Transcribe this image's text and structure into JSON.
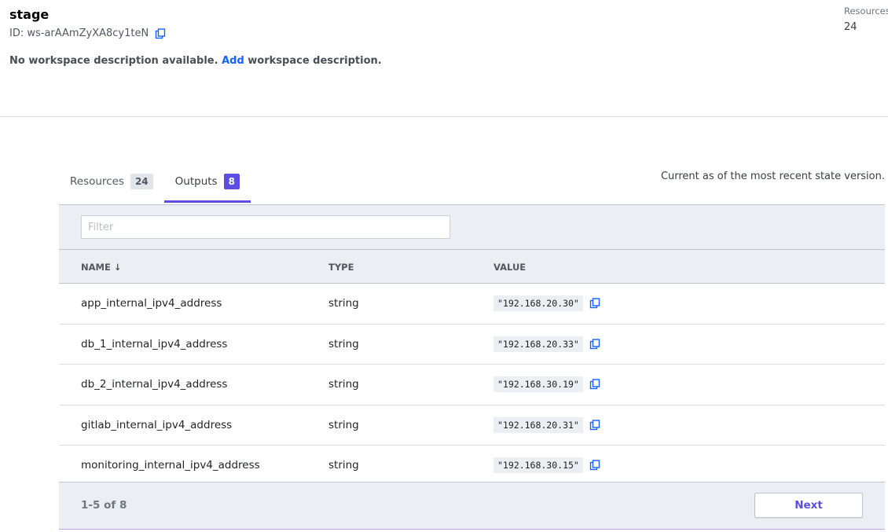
{
  "workspace": {
    "name": "stage",
    "id_label": "ID: ws-arAAmZyXA8cy1teN",
    "desc_prefix": "No workspace description available.",
    "desc_link": "Add",
    "desc_suffix": "workspace description."
  },
  "resources_summary": {
    "label": "Resources",
    "value": "24"
  },
  "tabs": [
    {
      "label": "Resources",
      "count": "24",
      "active": false
    },
    {
      "label": "Outputs",
      "count": "8",
      "active": true
    }
  ],
  "state_note": "Current as of the most recent state version.",
  "filter": {
    "placeholder": "Filter",
    "value": ""
  },
  "table": {
    "columns": {
      "name": "NAME",
      "name_sort": "↓",
      "type": "TYPE",
      "value": "VALUE"
    },
    "rows": [
      {
        "name": "app_internal_ipv4_address",
        "type": "string",
        "value": "\"192.168.20.30\""
      },
      {
        "name": "db_1_internal_ipv4_address",
        "type": "string",
        "value": "\"192.168.20.33\""
      },
      {
        "name": "db_2_internal_ipv4_address",
        "type": "string",
        "value": "\"192.168.30.19\""
      },
      {
        "name": "gitlab_internal_ipv4_address",
        "type": "string",
        "value": "\"192.168.20.31\""
      },
      {
        "name": "monitoring_internal_ipv4_address",
        "type": "string",
        "value": "\"192.168.30.15\""
      }
    ]
  },
  "pagination": {
    "info": "1-5 of 8",
    "next_label": "Next"
  },
  "icons": {
    "copy": "copy-icon",
    "sort": "arrow-down-icon"
  },
  "colors": {
    "accent": "#5c4ee5",
    "link": "#1563ff",
    "copy_icon": "#1563ff"
  }
}
